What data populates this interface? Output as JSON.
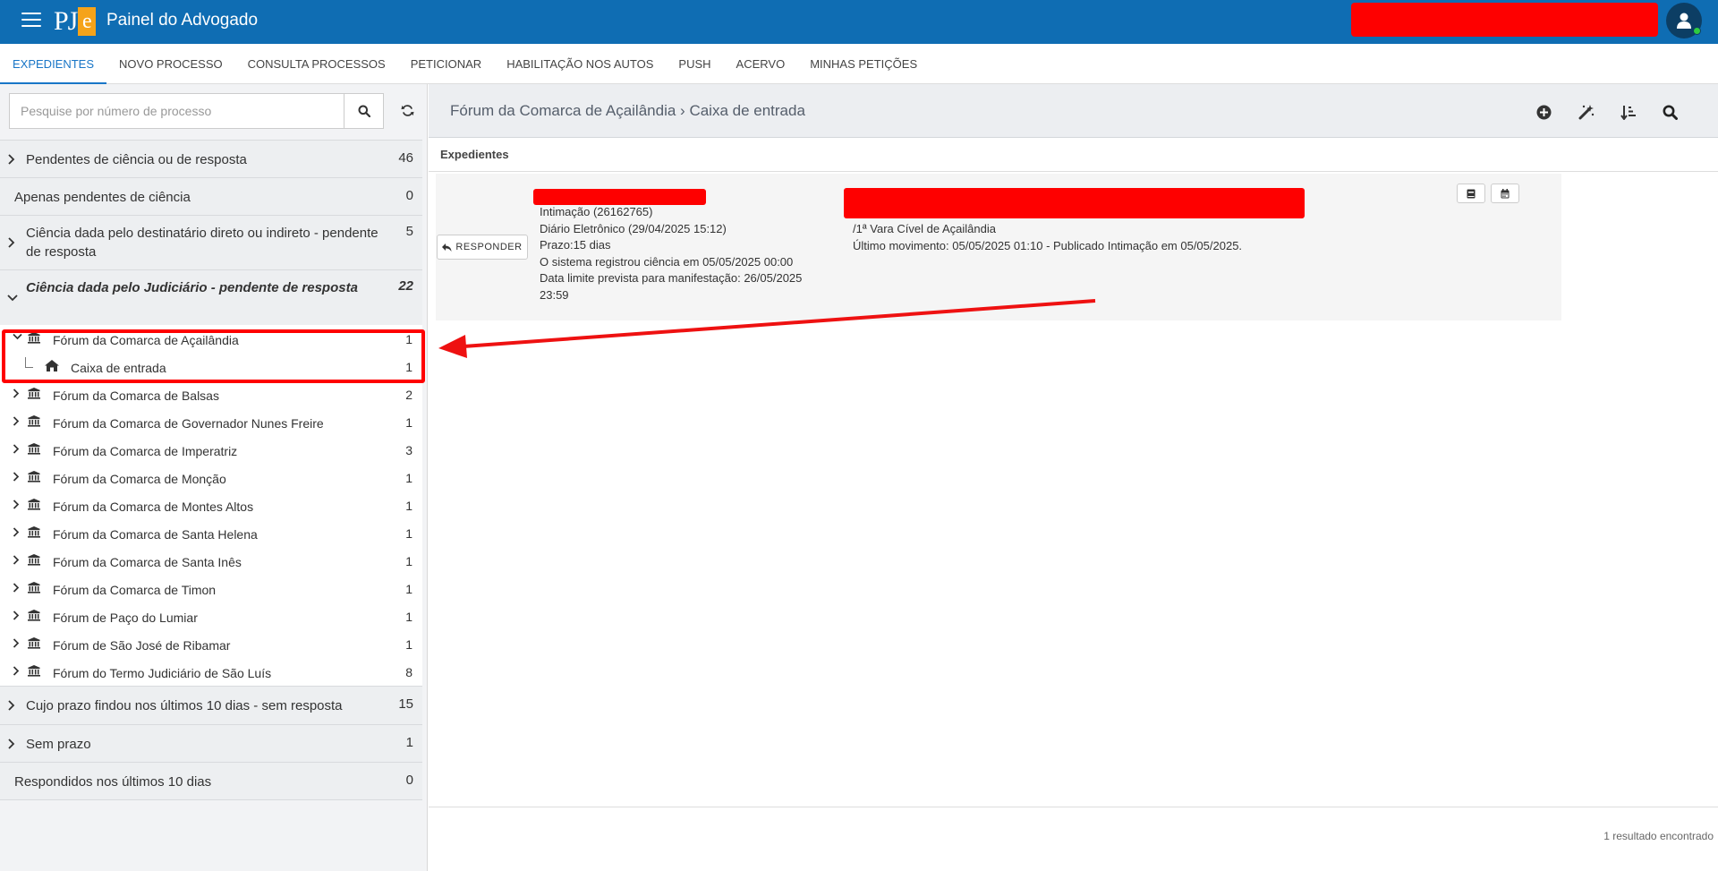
{
  "app": {
    "title": "Painel do Advogado",
    "logo_text": "PJ",
    "logo_letter": "e"
  },
  "tabs": [
    {
      "label": "EXPEDIENTES"
    },
    {
      "label": "NOVO PROCESSO"
    },
    {
      "label": "CONSULTA PROCESSOS"
    },
    {
      "label": "PETICIONAR"
    },
    {
      "label": "HABILITAÇÃO NOS AUTOS"
    },
    {
      "label": "PUSH"
    },
    {
      "label": "ACERVO"
    },
    {
      "label": "MINHAS PETIÇÕES"
    }
  ],
  "search": {
    "placeholder": "Pesquise por número de processo"
  },
  "groups": [
    {
      "label": "Pendentes de ciência ou de resposta",
      "count": "46"
    },
    {
      "label": "Apenas pendentes de ciência",
      "count": "0"
    },
    {
      "label": "Ciência dada pelo destinatário direto ou indireto - pendente de resposta",
      "count": "5"
    },
    {
      "label": "Ciência dada pelo Judiciário - pendente de resposta",
      "count": "22"
    },
    {
      "label": "Cujo prazo findou nos últimos 10 dias - sem resposta",
      "count": "15"
    },
    {
      "label": "Sem prazo",
      "count": "1"
    },
    {
      "label": "Respondidos nos últimos 10 dias",
      "count": "0"
    }
  ],
  "forums": [
    {
      "label": "Fórum da Comarca de Açailândia",
      "count": "1"
    },
    {
      "label": "Caixa de entrada",
      "count": "1"
    },
    {
      "label": "Fórum da Comarca de Balsas",
      "count": "2"
    },
    {
      "label": "Fórum da Comarca de Governador Nunes Freire",
      "count": "1"
    },
    {
      "label": "Fórum da Comarca de Imperatriz",
      "count": "3"
    },
    {
      "label": "Fórum da Comarca de Monção",
      "count": "1"
    },
    {
      "label": "Fórum da Comarca de Montes Altos",
      "count": "1"
    },
    {
      "label": "Fórum da Comarca de Santa Helena",
      "count": "1"
    },
    {
      "label": "Fórum da Comarca de Santa Inês",
      "count": "1"
    },
    {
      "label": "Fórum da Comarca de Timon",
      "count": "1"
    },
    {
      "label": "Fórum de Paço do Lumiar",
      "count": "1"
    },
    {
      "label": "Fórum de São José de Ribamar",
      "count": "1"
    },
    {
      "label": "Fórum do Termo Judiciário de São Luís",
      "count": "8"
    }
  ],
  "breadcrumb": {
    "court": "Fórum da Comarca de Açailândia",
    "separator": "›",
    "box": "Caixa de entrada"
  },
  "section_title": "Expedientes",
  "card": {
    "reply_label": "RESPONDER",
    "lines_left": [
      "Intimação (26162765)",
      "Diário Eletrônico (29/04/2025 15:12)",
      "Prazo:15 dias",
      "O sistema registrou ciência em 05/05/2025 00:00",
      "Data limite prevista para manifestação: 26/05/2025",
      "23:59"
    ],
    "lines_right": [
      "/1ª Vara Cível de Açailândia",
      "Último movimento: 05/05/2025 01:10 - Publicado Intimação em 05/05/2025."
    ]
  },
  "footer": {
    "result_text": "1 resultado encontrado"
  },
  "colors": {
    "topbar": "#0f6db3",
    "accent": "#1976c7",
    "redaction": "#fe0000",
    "logo_e": "#f5a31a"
  }
}
